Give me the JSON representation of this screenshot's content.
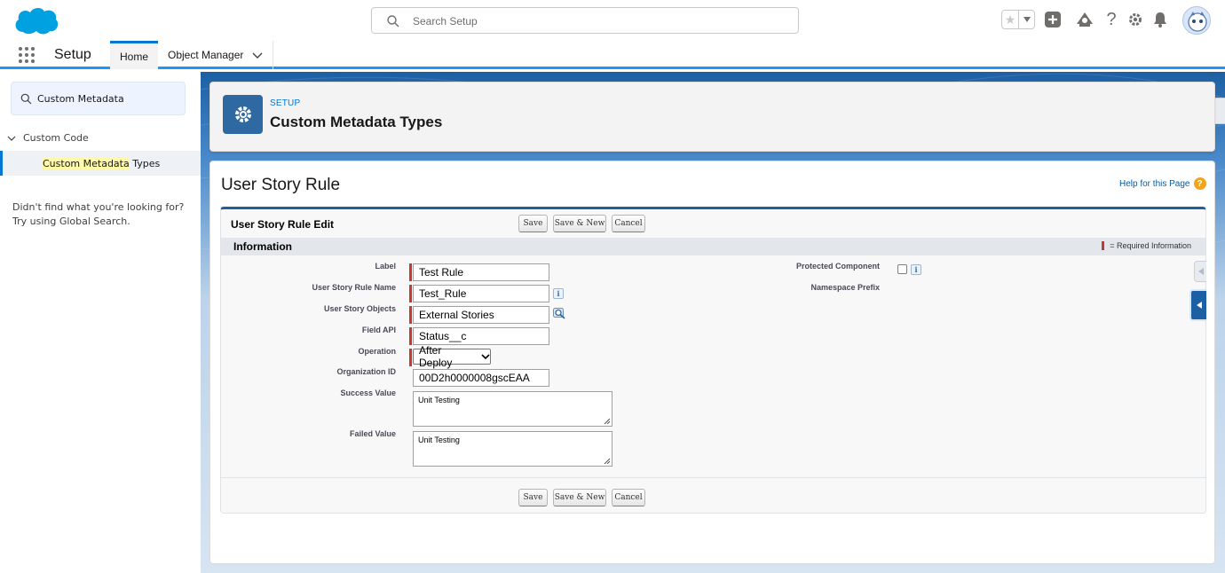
{
  "header": {
    "search_placeholder": "Search Setup",
    "icons": [
      "salesforce-cloud-logo",
      "search-icon",
      "star-icon",
      "chevron-down-icon",
      "add-icon",
      "trailhead-icon",
      "help-icon",
      "gear-icon",
      "bell-icon",
      "avatar"
    ]
  },
  "nav": {
    "app_name": "Setup",
    "tabs": [
      {
        "label": "Home",
        "active": true
      },
      {
        "label": "Object Manager",
        "has_dropdown": true
      }
    ]
  },
  "sidebar": {
    "quickfind_value": "Custom Metadata",
    "tree": {
      "node_label": "Custom Code",
      "leaf_label_highlight": "Custom Metadata",
      "leaf_label_rest": " Types"
    },
    "not_found_line1": "Didn't find what you're looking for?",
    "not_found_line2": "Try using Global Search."
  },
  "page_header": {
    "eyebrow": "SETUP",
    "title": "Custom Metadata Types"
  },
  "record": {
    "title": "User Story Rule",
    "help_link": "Help for this Page"
  },
  "form": {
    "block_title": "User Story Rule Edit",
    "buttons": {
      "save": "Save",
      "save_new": "Save & New",
      "cancel": "Cancel"
    },
    "section_title": "Information",
    "required_legend": "= Required Information",
    "fields": {
      "label": {
        "label": "Label",
        "value": "Test Rule",
        "required": true
      },
      "rule_name": {
        "label": "User Story Rule Name",
        "value": "Test_Rule",
        "required": true
      },
      "objects": {
        "label": "User Story Objects",
        "value": "External Stories",
        "required": true
      },
      "field_api": {
        "label": "Field API",
        "value": "Status__c",
        "required": true
      },
      "operation": {
        "label": "Operation",
        "value": "After Deploy",
        "required": true
      },
      "org_id": {
        "label": "Organization ID",
        "value": "00D2h0000008gscEAA",
        "required": false
      },
      "success_value": {
        "label": "Success Value",
        "value": "Unit Testing"
      },
      "failed_value": {
        "label": "Failed Value",
        "value": "Unit Testing"
      },
      "protected_component": {
        "label": "Protected Component",
        "checked": false
      },
      "namespace_prefix": {
        "label": "Namespace Prefix",
        "value": ""
      }
    }
  },
  "colors": {
    "brand_blue": "#0176d3",
    "header_blue": "#1c5fa3",
    "required_red": "#c23934",
    "highlight_yellow": "#fff9a8"
  }
}
